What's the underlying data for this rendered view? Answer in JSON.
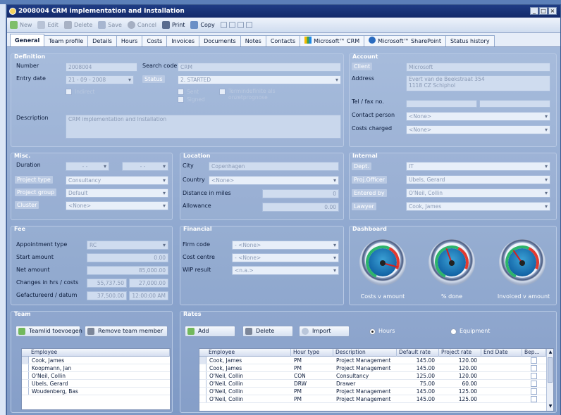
{
  "window": {
    "title": "2008004 CRM implementation and Installation"
  },
  "toolbar": {
    "new": "New",
    "edit": "Edit",
    "delete": "Delete",
    "save": "Save",
    "cancel": "Cancel",
    "print": "Print",
    "copy": "Copy"
  },
  "tabs": [
    "General",
    "Team profile",
    "Details",
    "Hours",
    "Costs",
    "Invoices",
    "Documents",
    "Notes",
    "Contacts",
    "Microsoft™ CRM",
    "Microsoft™ SharePoint",
    "Status history"
  ],
  "definition": {
    "title": "Definition",
    "number_label": "Number",
    "number": "2008004",
    "search_code_label": "Search code",
    "search_code": "CRM",
    "entry_date_label": "Entry date",
    "entry_date": "21 - 09 - 2008",
    "status_label": "Status",
    "status": "2. STARTED",
    "indirect": "Indirect",
    "sent": "Sent",
    "signed": "Signed",
    "indefinite": "Termindefinite als\nonzetprognose",
    "description_label": "Description",
    "description": "CRM implementation and Installation"
  },
  "account": {
    "title": "Account",
    "client_label": "Client",
    "client": "Microsoft",
    "address_label": "Address",
    "address1": "Evert van de Beekstraat 354",
    "address2": "1118 CZ Schiphol",
    "tel_label": "Tel / fax no.",
    "contact_label": "Contact person",
    "contact": "<None>",
    "costs_label": "Costs charged",
    "costs": "<None>"
  },
  "misc": {
    "title": "Misc.",
    "duration_label": "Duration",
    "duration1": "-  -",
    "duration2": "-  -",
    "project_type_label": "Project type",
    "project_type": "Consultancy",
    "project_group_label": "Project group",
    "project_group": "Default",
    "cluster_label": "Cluster",
    "cluster": "<None>"
  },
  "location": {
    "title": "Location",
    "city_label": "City",
    "city": "Copenhagen",
    "country_label": "Country",
    "country": "<None>",
    "distance_label": "Distance in miles",
    "distance": "0",
    "allowance_label": "Allowance",
    "allowance": "0.00"
  },
  "internal": {
    "title": "Internal",
    "dept_label": "Dept.",
    "dept": "IT",
    "officer_label": "Proj.Officer",
    "officer": "Ubels, Gerard",
    "entered_label": "Entered by",
    "entered": "O'Neil, Collin",
    "lawyer_label": "Lawyer",
    "lawyer": "Cook, James"
  },
  "fee": {
    "title": "Fee",
    "appointment_label": "Appointment type",
    "appointment": "RC",
    "start_label": "Start amount",
    "start": "0.00",
    "net_label": "Net amount",
    "net": "85,000.00",
    "changes_label": "Changes in hrs / costs",
    "changes1": "55,737.50",
    "changes2": "27,000.00",
    "invoiced_label": "Gefactureerd / datum",
    "invoiced1": "37,500.00",
    "invoiced2": "12:00:00 AM"
  },
  "financial": {
    "title": "Financial",
    "firm_label": "Firm code",
    "firm": "- <None>",
    "cost_centre_label": "Cost centre",
    "cost_centre": "- <None>",
    "wip_label": "WIP result",
    "wip": "<n.a.>"
  },
  "dashboard": {
    "title": "Dashboard",
    "gauges": [
      {
        "label": "Costs v amount"
      },
      {
        "label": "% done"
      },
      {
        "label": "Invoiced v amount"
      }
    ]
  },
  "team": {
    "title": "Team",
    "add_button": "Teamlid toevoegen",
    "remove_button": "Remove team member",
    "column": "Employee",
    "members": [
      "Cook, James",
      "Koopmann, Jan",
      "O'Neil, Collin",
      "Ubels, Gerard",
      "Woudenberg, Bas"
    ]
  },
  "rates": {
    "title": "Rates",
    "add_button": "Add",
    "delete_button": "Delete",
    "import_button": "Import",
    "hours_option": "Hours",
    "equipment_option": "Equipment",
    "columns": [
      "Employee",
      "Hour type",
      "Description",
      "Default rate",
      "Project rate",
      "End Date",
      "Bep..."
    ],
    "rows": [
      [
        "Cook, James",
        "PM",
        "Project Management",
        "145.00",
        "120.00",
        ""
      ],
      [
        "Cook, James",
        "PM",
        "Project Management",
        "145.00",
        "120.00",
        ""
      ],
      [
        "O'Neil, Collin",
        "CON",
        "Consultancy",
        "125.00",
        "120.00",
        ""
      ],
      [
        "O'Neil, Collin",
        "DRW",
        "Drawer",
        "75.00",
        "60.00",
        ""
      ],
      [
        "O'Neil, Collin",
        "PM",
        "Project Management",
        "145.00",
        "125.00",
        ""
      ],
      [
        "O'Neil, Collin",
        "PM",
        "Project Management",
        "145.00",
        "125.00",
        ""
      ]
    ]
  }
}
